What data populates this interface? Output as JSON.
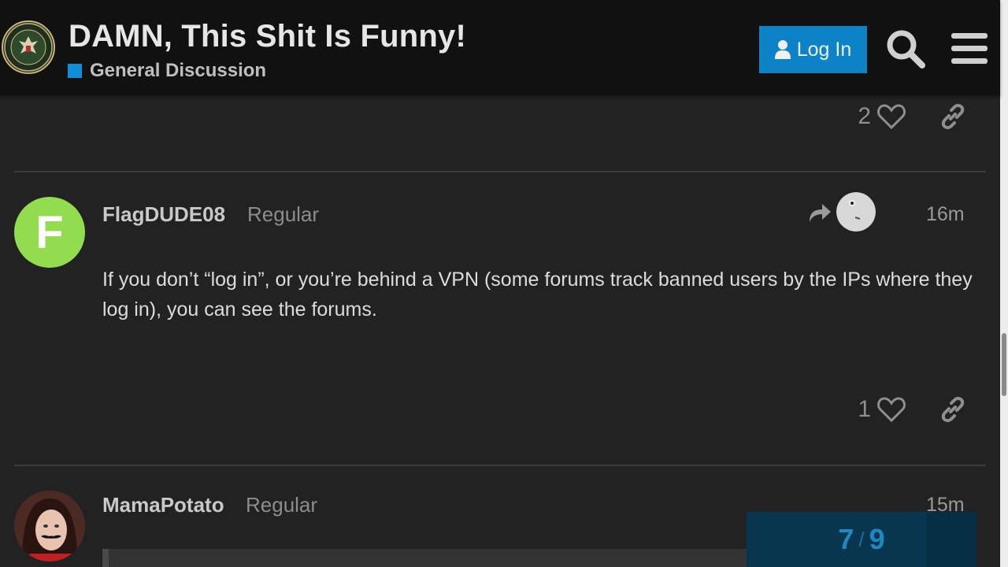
{
  "header": {
    "title": "DAMN, This Shit Is Funny!",
    "category": "General Discussion",
    "login_label": "Log In",
    "logo_text": "INFOWARS ARMY"
  },
  "colors": {
    "accent": "#0b83c6",
    "category": "#0e8fd7",
    "background": "#222222",
    "header": "#111111"
  },
  "posts": [
    {
      "likes": "2"
    },
    {
      "username": "FlagDUDE08",
      "user_title": "Regular",
      "time": "16m",
      "avatar_letter": "F",
      "avatar_color": "#91dd4f",
      "body": "If you don’t “log in”, or you’re behind a VPN (some forums track banned users by the IPs where they log in), you can see the forums.",
      "likes": "1"
    },
    {
      "username": "MamaPotato",
      "user_title": "Regular",
      "time": "15m"
    }
  ],
  "progress": {
    "current": "7",
    "total": "9",
    "fraction": 0.78
  }
}
